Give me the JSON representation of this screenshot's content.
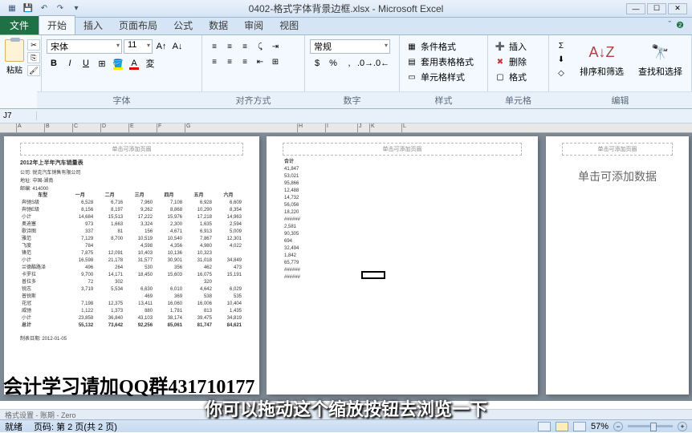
{
  "title": "0402-格式字体背景边框.xlsx - Microsoft Excel",
  "tabs": {
    "file": "文件",
    "t0": "开始",
    "t1": "插入",
    "t2": "页面布局",
    "t3": "公式",
    "t4": "数据",
    "t5": "审阅",
    "t6": "视图"
  },
  "ribbon": {
    "paste": "粘贴",
    "font_name": "宋体",
    "font_size": "11",
    "btn_b": "B",
    "btn_i": "I",
    "btn_u": "U",
    "grp_font": "字体",
    "grp_align": "对齐方式",
    "grp_num": "数字",
    "grp_style": "样式",
    "grp_cell": "单元格",
    "grp_edit": "编辑",
    "num_fmt": "常规",
    "cond_fmt": "条件格式",
    "tbl_fmt": "套用表格格式",
    "cell_fmt": "单元格样式",
    "insert": "插入",
    "delete": "删除",
    "format": "格式",
    "sort": "排序和筛选",
    "find": "查找和选择"
  },
  "namebox": "J7",
  "page_hdr_hint": "单击可添加页眉",
  "page3_hint": "单击可添加数据",
  "report": {
    "title": "2012年上半年汽车销量表",
    "company": "公司: 锐克汽车销售有限公司",
    "addr": "地址: 中国-湖南",
    "zip": "邮编: 414000",
    "headers": [
      "车型",
      "一月",
      "二月",
      "三月",
      "四月",
      "五月",
      "六月"
    ],
    "rows_a": [
      [
        "奔驰S级",
        "6,528",
        "6,716",
        "7,960",
        "7,108",
        "6,928",
        "6,609"
      ],
      [
        "奔驰E级",
        "8,156",
        "8,197",
        "9,262",
        "8,868",
        "10,290",
        "8,354"
      ],
      [
        "小计",
        "14,684",
        "15,513",
        "17,222",
        "15,976",
        "17,218",
        "14,963"
      ]
    ],
    "rows_b": [
      [
        "奥迪塞",
        "973",
        "1,663",
        "3,324",
        "2,300",
        "1,635",
        "2,594"
      ],
      [
        "歌诗图",
        "337",
        "81",
        "156",
        "4,671",
        "6,913",
        "5,009"
      ],
      [
        "雅范",
        "7,129",
        "8,700",
        "10,519",
        "10,540",
        "7,867",
        "12,301"
      ],
      [
        "飞度",
        "784",
        "",
        "4,598",
        "4,356",
        "4,980",
        "4,022"
      ],
      [
        "锋范",
        "7,875",
        "12,091",
        "10,403",
        "10,136",
        "10,323",
        ""
      ],
      [
        "小计",
        "16,598",
        "21,178",
        "31,577",
        "30,901",
        "31,018",
        "34,849"
      ]
    ],
    "rows_c": [
      [
        "兰德酷路泽",
        "496",
        "264",
        "530",
        "356",
        "462",
        "473"
      ],
      [
        "卡罗拉",
        "9,700",
        "14,171",
        "18,450",
        "15,603",
        "16,075",
        "15,191"
      ],
      [
        "普拉多",
        "72",
        "302",
        "",
        "",
        "320",
        ""
      ],
      [
        "锐志",
        "3,719",
        "5,534",
        "6,630",
        "6,010",
        "4,642",
        "6,029"
      ],
      [
        "普锐斯",
        "",
        "",
        "469",
        "369",
        "538",
        "535"
      ],
      [
        "花冠",
        "7,198",
        "12,375",
        "13,411",
        "16,060",
        "16,006",
        "10,404"
      ],
      [
        "威驰",
        "1,122",
        "1,373",
        "880",
        "1,781",
        "813",
        "1,435"
      ],
      [
        "小计",
        "23,858",
        "36,840",
        "43,103",
        "38,174",
        "39,475",
        "34,819"
      ]
    ],
    "total": [
      "总计",
      "55,132",
      "73,642",
      "92,256",
      "85,061",
      "81,747",
      "84,621"
    ],
    "date_lbl": "制表日期:",
    "date": "2012-01-05",
    "sum_hdr": "合计",
    "sum_a": [
      "41,847",
      "53,021",
      "95,866"
    ],
    "sum_b": [
      "12,488",
      "14,732",
      "56,056",
      "18,220",
      "",
      "######"
    ],
    "sum_c": [
      "2,581",
      "90,305",
      "694",
      "32,494",
      "1,842",
      "65,779",
      "",
      "######"
    ],
    "sum_total": "######"
  },
  "ruler_letters": [
    "A",
    "B",
    "C",
    "D",
    "E",
    "F",
    "G",
    "H",
    "I",
    "J",
    "K",
    "L"
  ],
  "sheet_info": "格式设置 - 账期 - Zero",
  "status": {
    "ready": "就绪",
    "page": "页码: 第 2 页(共 2 页)",
    "zoom": "57%"
  },
  "overlay1": "会计学习请加QQ群431710177",
  "overlay2": "你可以拖动这个缩放按钮去浏览一下"
}
